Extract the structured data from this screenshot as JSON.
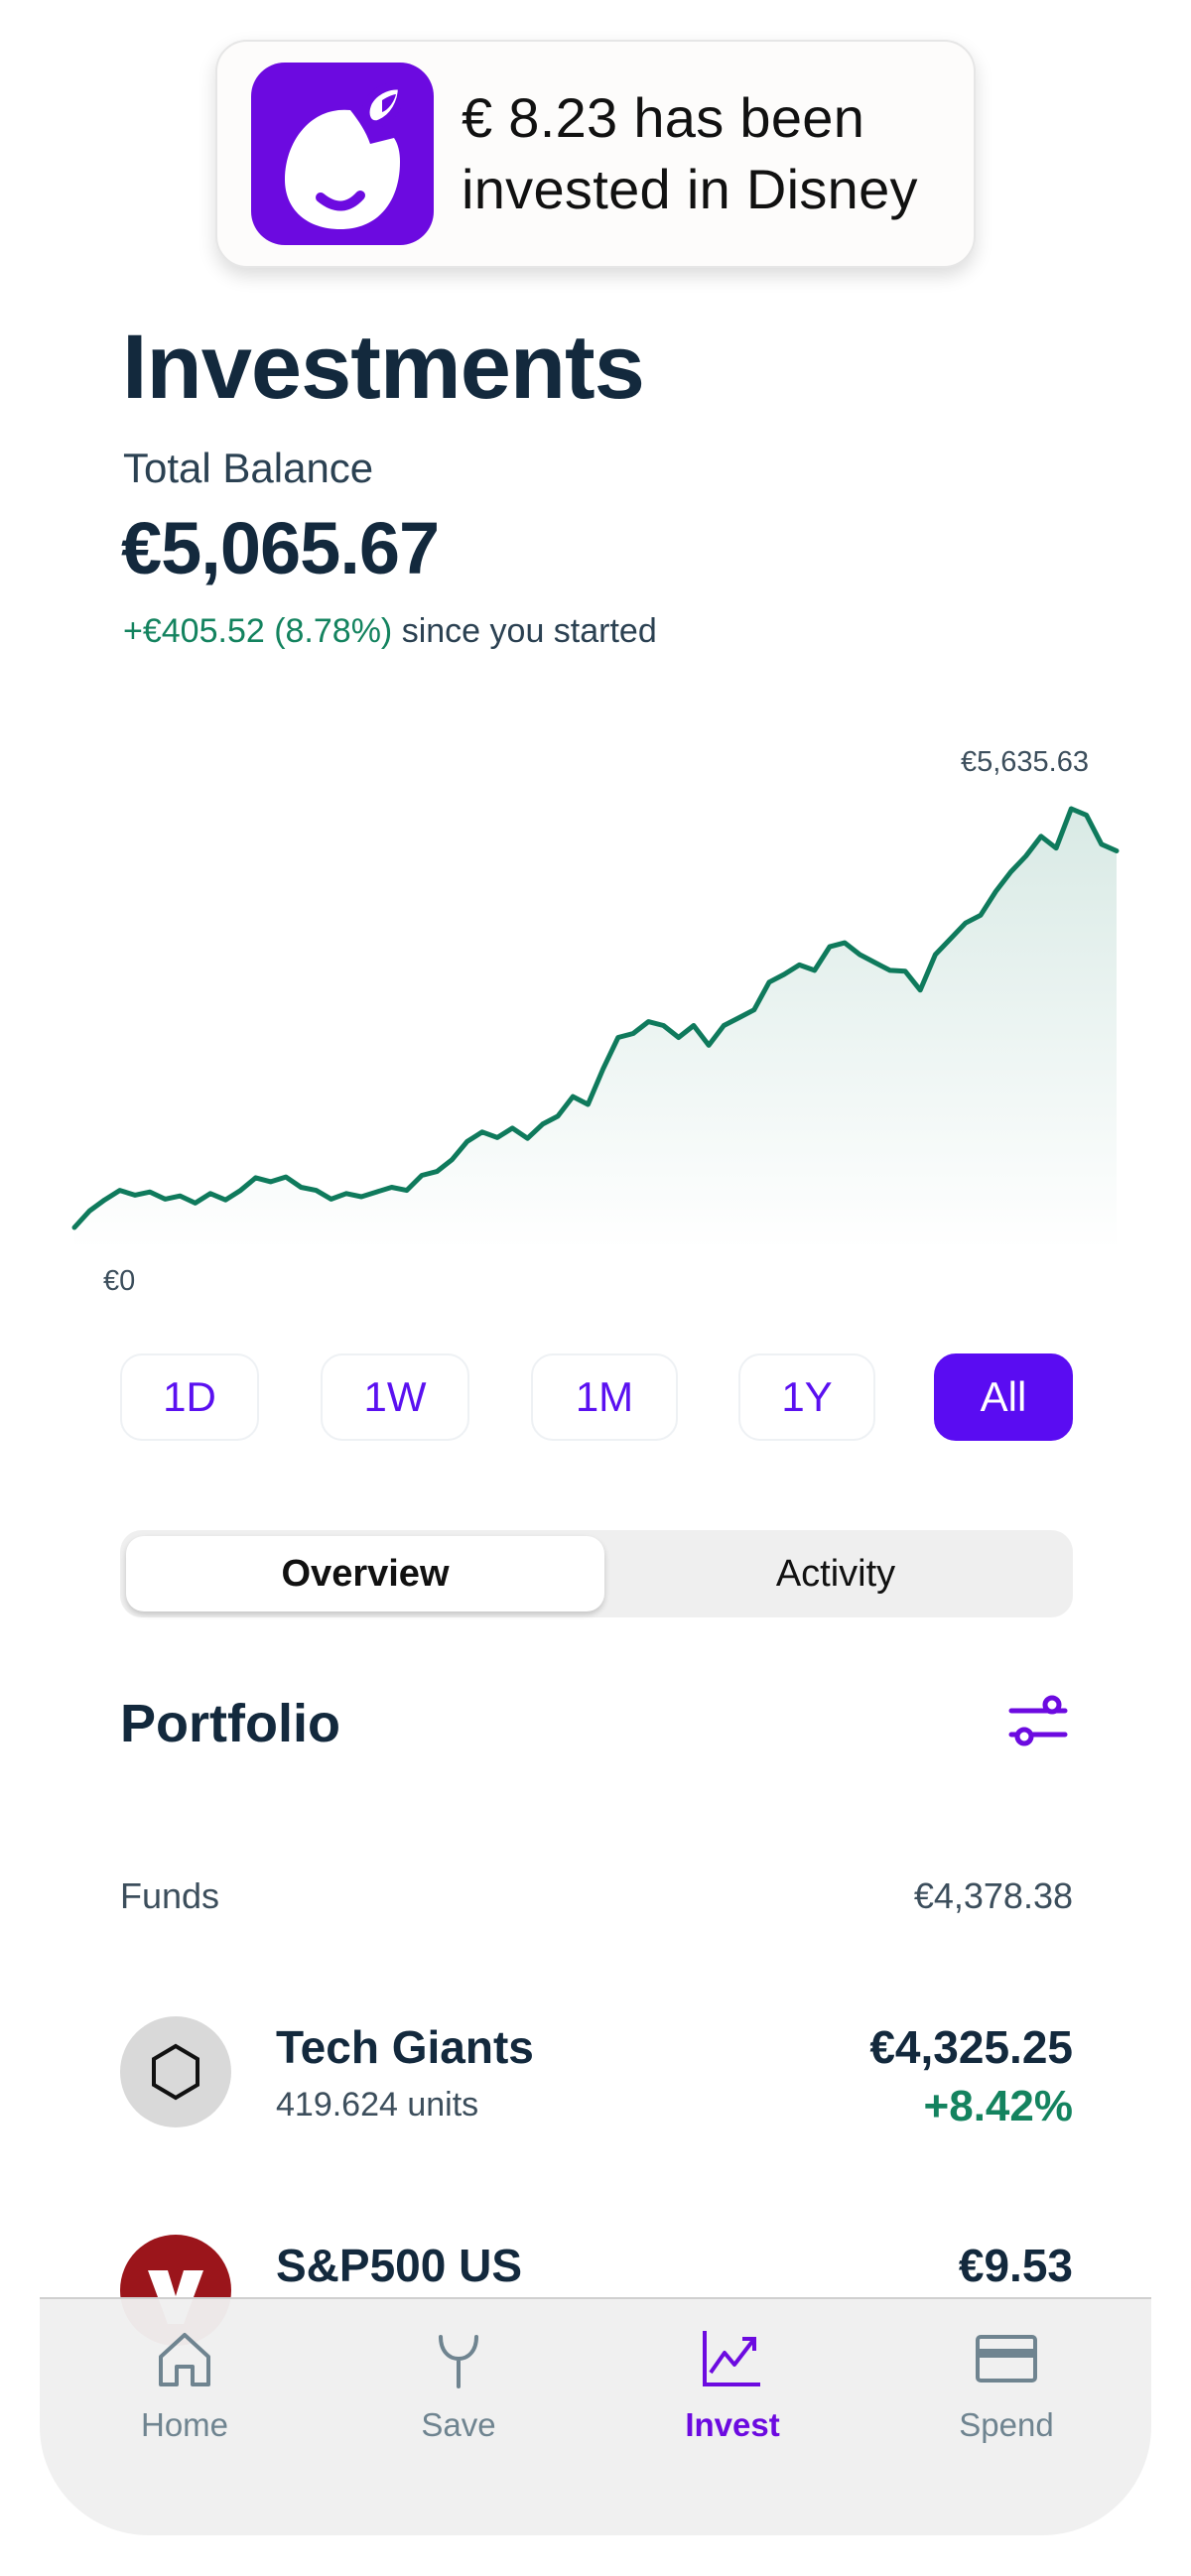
{
  "notification": {
    "app_icon": "app-logo-icon",
    "message_line1": "€ 8.23 has been",
    "message_line2": "invested in Disney"
  },
  "header": {
    "title": "Investments",
    "balance_label": "Total Balance",
    "balance_value": "€5,065.67",
    "gain": "+€405.52 (8.78%)",
    "gain_suffix": " since you started"
  },
  "colors": {
    "accent": "#5a0cf2",
    "brand_purple": "#6c0ae0",
    "positive": "#14835f",
    "line": "#0f7a5c",
    "text_dark": "#13293d"
  },
  "chart_data": {
    "type": "area",
    "title": "",
    "max_label": "€5,635.63",
    "min_label": "€0",
    "xlabel": "",
    "ylabel": "",
    "grid": false,
    "ylim": [
      0,
      5635.63
    ],
    "x": [
      0,
      1,
      2,
      3,
      4,
      5,
      6,
      7,
      8,
      9,
      10,
      11,
      12,
      13,
      14,
      15,
      16,
      17,
      18,
      19,
      20,
      21,
      22,
      23,
      24,
      25,
      26,
      27,
      28,
      29,
      30,
      31,
      32,
      33,
      34,
      35,
      36,
      37,
      38,
      39,
      40,
      41,
      42,
      43,
      44,
      45,
      46,
      47,
      48,
      49,
      50,
      51,
      52,
      53,
      54,
      55,
      56,
      57,
      58,
      59,
      60,
      61,
      62,
      63,
      64,
      65,
      66,
      67,
      68,
      69
    ],
    "values": [
      290,
      500,
      640,
      760,
      700,
      740,
      650,
      690,
      600,
      720,
      640,
      760,
      920,
      870,
      930,
      800,
      760,
      650,
      720,
      680,
      740,
      800,
      760,
      950,
      1000,
      1150,
      1380,
      1500,
      1430,
      1550,
      1420,
      1600,
      1700,
      1950,
      1850,
      2300,
      2700,
      2750,
      2900,
      2850,
      2700,
      2850,
      2600,
      2850,
      2950,
      3050,
      3400,
      3500,
      3620,
      3550,
      3850,
      3900,
      3750,
      3650,
      3550,
      3540,
      3300,
      3750,
      3950,
      4150,
      4250,
      4550,
      4800,
      5000,
      5250,
      5100,
      5600,
      5520,
      5150,
      5065.67
    ]
  },
  "ranges": [
    {
      "label": "1D",
      "active": false
    },
    {
      "label": "1W",
      "active": false
    },
    {
      "label": "1M",
      "active": false
    },
    {
      "label": "1Y",
      "active": false
    },
    {
      "label": "All",
      "active": true
    }
  ],
  "segments": [
    {
      "label": "Overview",
      "active": true
    },
    {
      "label": "Activity",
      "active": false
    }
  ],
  "portfolio": {
    "title": "Portfolio",
    "filter_icon": "sliders-icon",
    "group_label": "Funds",
    "group_value": "€4,378.38",
    "holdings": [
      {
        "name": "Tech Giants",
        "units": "419.624 units",
        "value": "€4,325.25",
        "change": "+8.42%",
        "icon": "hexagon-icon"
      },
      {
        "name": "S&P500 US",
        "units": "",
        "value": "€9.53",
        "change": "",
        "icon": "vanguard-logo-icon"
      }
    ]
  },
  "tabbar": [
    {
      "label": "Home",
      "icon": "home-icon",
      "active": false
    },
    {
      "label": "Save",
      "icon": "sprout-icon",
      "active": false
    },
    {
      "label": "Invest",
      "icon": "chart-trend-icon",
      "active": true
    },
    {
      "label": "Spend",
      "icon": "card-icon",
      "active": false
    }
  ]
}
